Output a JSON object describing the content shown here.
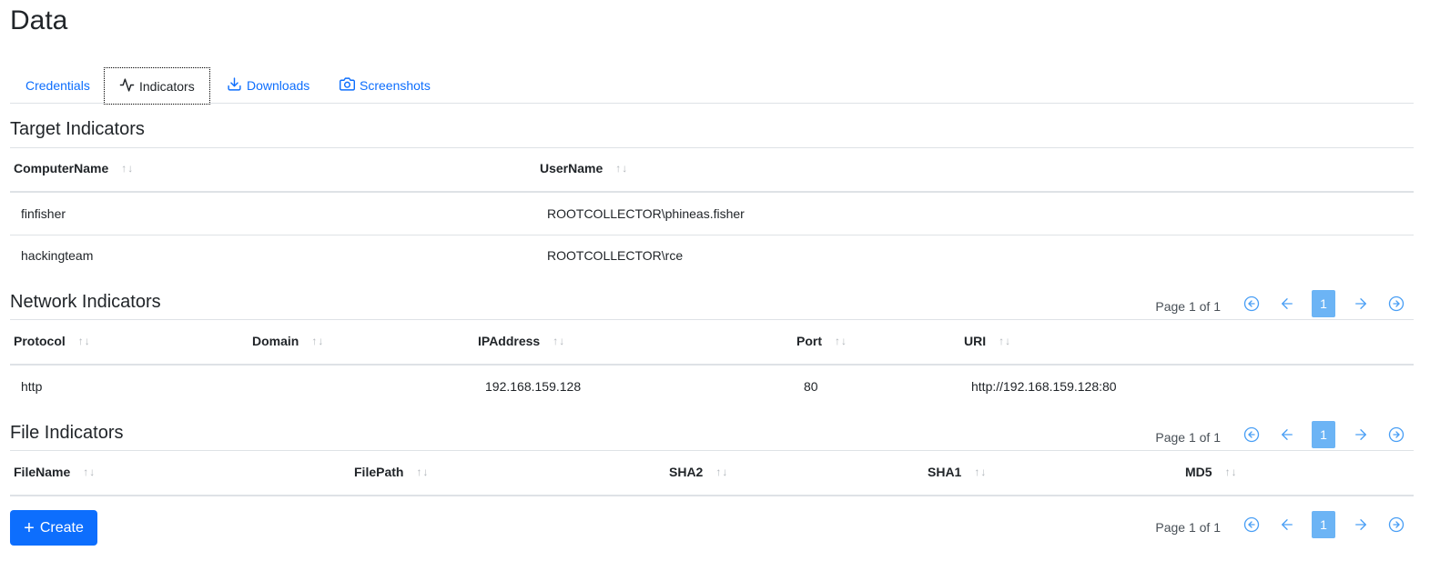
{
  "page": {
    "title": "Data"
  },
  "tabs": [
    {
      "label": "Credentials",
      "icon": "none"
    },
    {
      "label": "Indicators",
      "icon": "activity-icon"
    },
    {
      "label": "Downloads",
      "icon": "download-icon"
    },
    {
      "label": "Screenshots",
      "icon": "camera-icon"
    }
  ],
  "target": {
    "title": "Target Indicators",
    "columns": [
      "ComputerName",
      "UserName"
    ],
    "rows": [
      [
        "finfisher",
        "ROOTCOLLECTOR\\phineas.fisher"
      ],
      [
        "hackingteam",
        "ROOTCOLLECTOR\\rce"
      ]
    ],
    "pager": {
      "info": "Page 1 of 1",
      "page": "1"
    }
  },
  "network": {
    "title": "Network Indicators",
    "columns": [
      "Protocol",
      "Domain",
      "IPAddress",
      "Port",
      "URI"
    ],
    "rows": [
      [
        "http",
        "",
        "192.168.159.128",
        "80",
        "http://192.168.159.128:80"
      ]
    ],
    "pager": {
      "info": "Page 1 of 1",
      "page": "1"
    }
  },
  "file": {
    "title": "File Indicators",
    "columns": [
      "FileName",
      "FilePath",
      "SHA2",
      "SHA1",
      "MD5"
    ],
    "rows": [],
    "pager": {
      "info": "Page 1 of 1",
      "page": "1"
    }
  },
  "sort_glyph": "↑↓",
  "create": {
    "label": "Create"
  },
  "colors": {
    "link": "#0d6efd",
    "primary": "#0d6efd",
    "pager_active": "#6cb4f5",
    "pager_icon": "#4a9ff5"
  }
}
